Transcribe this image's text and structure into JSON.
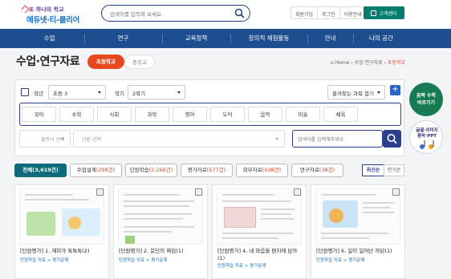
{
  "header": {
    "logo_top": "또 하나의 학교",
    "logo_main": "에듀넷·티-클리어",
    "search_placeholder": "검색어를 입력해 보세요.",
    "util_links": [
      "회원가입",
      "로그인",
      "이용안내"
    ],
    "cs_label": "고객센터"
  },
  "nav": {
    "items": [
      "수업",
      "연구",
      "교육정책",
      "창의적 체험활동",
      "안내",
      "나의 공간"
    ]
  },
  "page": {
    "title": "수업·연구자료",
    "level_tabs": [
      "초등학교",
      "중학교"
    ],
    "breadcrumb": {
      "home": "Home",
      "mid": "수업·연구자료",
      "current": "초등학교"
    }
  },
  "filters": {
    "grade_label": "학년",
    "grade_value": "초등 3",
    "term_label": "학기",
    "term_value": "2학기",
    "favorite_label": "즐겨찾는 과목 열기",
    "subjects": [
      "국어",
      "수학",
      "사회",
      "과학",
      "영어",
      "도덕",
      "음악",
      "미술",
      "체육"
    ],
    "publisher_placeholder": "출판사 선택",
    "unit_placeholder": "단원 선택",
    "keyword_placeholder": "검색어를 입력해주세요"
  },
  "side": {
    "float1": [
      "꿈짝 수학",
      "바로가기"
    ],
    "float2": [
      "글꼴·이미지",
      "음악·PPT"
    ]
  },
  "tabs": [
    {
      "name": "전체",
      "count": "(3,619건)"
    },
    {
      "name": "수업설계",
      "count": "(298건)"
    },
    {
      "name": "단원학습",
      "count": "(2,268건)"
    },
    {
      "name": "평가자료",
      "count": "(577건)"
    },
    {
      "name": "외부자료",
      "count": "(438건)"
    },
    {
      "name": "연구자료",
      "count": "(38건)"
    }
  ],
  "sort": [
    "최신순",
    "인기순"
  ],
  "cards": [
    {
      "title": "[단원평가] 1. 재미가 톡톡톡(2)",
      "meta": "단원학습 자료 > 평가문제"
    },
    {
      "title": "[단원평가] 2. 문단의 짜임(1)",
      "meta": "단원학습 자료 > 평가문제"
    },
    {
      "title": "[단원평가] 4. 내 마음을 편지에 담아(1)",
      "meta": "단원학습 자료 > 평가문제"
    },
    {
      "title": "[단원평가] 6. 일이 일어난 까닭(1)",
      "meta": "단원학습 자료 > 평가문제"
    }
  ],
  "colors": {
    "nav": "#1d4e8f",
    "accent": "#e8481e",
    "active_tab": "#0e6b7a",
    "panel_border": "#2c3e8c"
  }
}
